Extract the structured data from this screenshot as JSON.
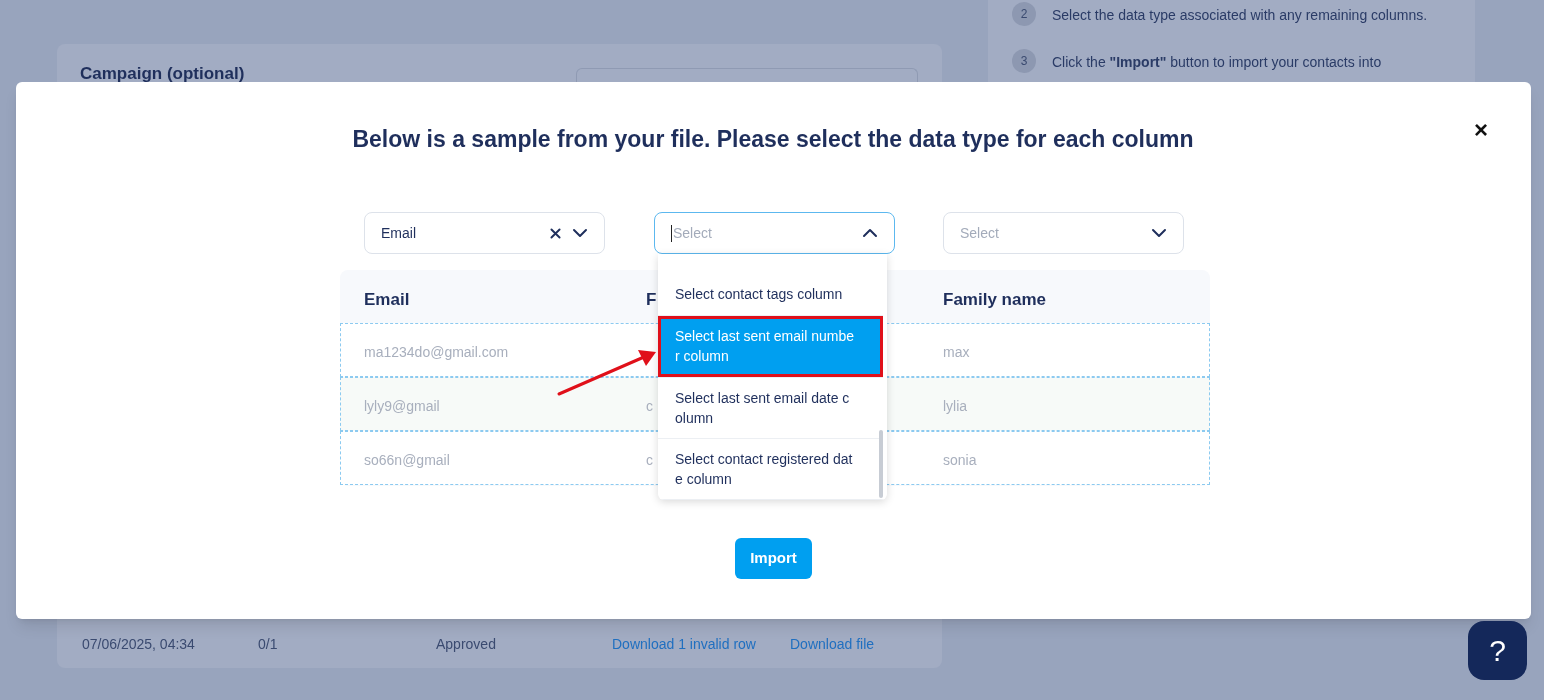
{
  "background": {
    "campaign_label": "Campaign (optional)",
    "steps": [
      {
        "number": "2",
        "text": "Select the data type associated with any remaining columns."
      },
      {
        "number": "3",
        "text": "Click the **\"Import\"** button to import your contacts into"
      }
    ],
    "history_row": {
      "date": "07/06/2025, 04:34",
      "count": "0/1",
      "status": "Approved",
      "invalid_link": "Download 1 invalid row",
      "file_link": "Download file"
    }
  },
  "modal": {
    "title": "Below is a sample from your file. Please select the data type for each column",
    "close": "×",
    "selects": [
      {
        "value": "Email",
        "open": false
      },
      {
        "placeholder": "Select",
        "open": true
      },
      {
        "placeholder": "Select",
        "open": false
      }
    ],
    "dropdown": {
      "options": [
        {
          "label": "Select contact tags column",
          "selected": false
        },
        {
          "label": "Select last sent email number column",
          "selected": true
        },
        {
          "label": "Select last sent email date column",
          "selected": false
        },
        {
          "label": "Select contact registered date column",
          "selected": false
        }
      ]
    },
    "table": {
      "columns": [
        "Email",
        "F",
        "Family name"
      ],
      "rows": [
        {
          "email": "ma1234do@gmail.com",
          "family_name": "max"
        },
        {
          "email": "lyly9@gmail",
          "column_2": "c",
          "family_name": "lylia"
        },
        {
          "email": "so66n@gmail",
          "column_2": "c",
          "family_name": "sonia"
        }
      ]
    },
    "import_button": "Import"
  },
  "help_button": "?"
}
